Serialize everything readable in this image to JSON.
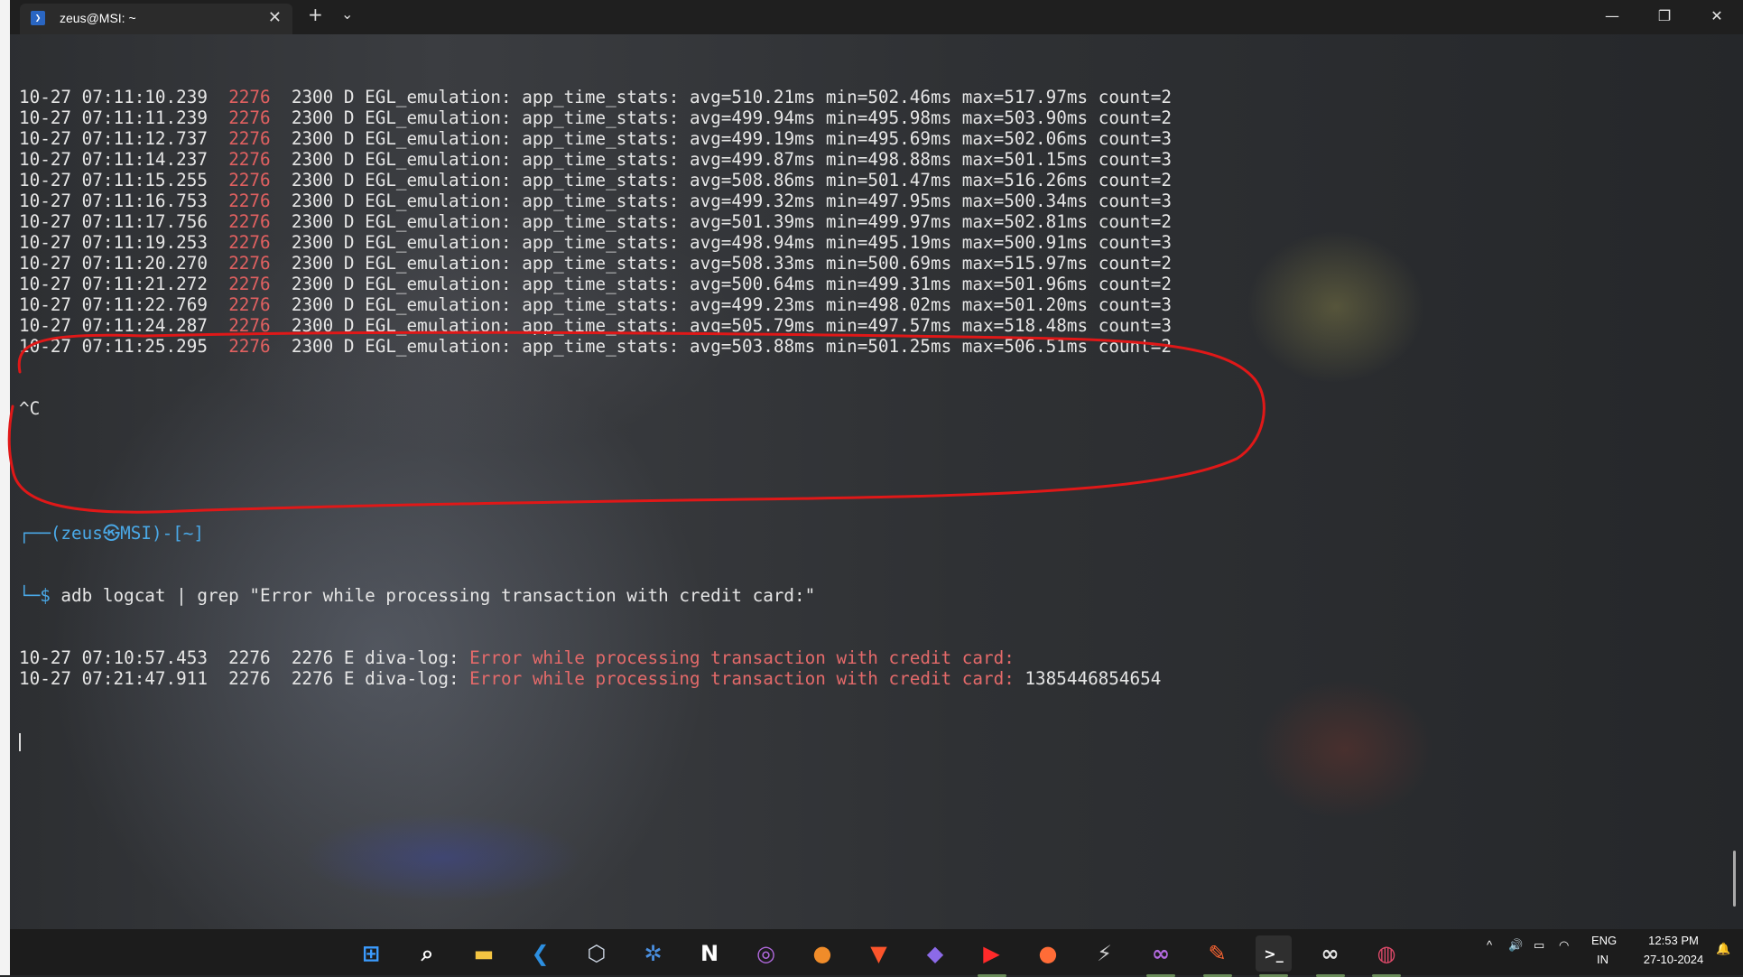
{
  "window": {
    "tab_title": "zeus@MSI: ~",
    "tab_icon": "powershell-icon",
    "new_tab": "+",
    "dropdown": "⌄",
    "minimize": "—",
    "restore": "❐",
    "close": "✕"
  },
  "log_lines": [
    {
      "date": "10-27",
      "time": "07:11:10.239",
      "pid": "2276",
      "tid": "2300",
      "level": "D",
      "tag": "EGL_emulation:",
      "msg": "app_time_stats: avg=510.21ms min=502.46ms max=517.97ms count=2"
    },
    {
      "date": "10-27",
      "time": "07:11:11.239",
      "pid": "2276",
      "tid": "2300",
      "level": "D",
      "tag": "EGL_emulation:",
      "msg": "app_time_stats: avg=499.94ms min=495.98ms max=503.90ms count=2"
    },
    {
      "date": "10-27",
      "time": "07:11:12.737",
      "pid": "2276",
      "tid": "2300",
      "level": "D",
      "tag": "EGL_emulation:",
      "msg": "app_time_stats: avg=499.19ms min=495.69ms max=502.06ms count=3"
    },
    {
      "date": "10-27",
      "time": "07:11:14.237",
      "pid": "2276",
      "tid": "2300",
      "level": "D",
      "tag": "EGL_emulation:",
      "msg": "app_time_stats: avg=499.87ms min=498.88ms max=501.15ms count=3"
    },
    {
      "date": "10-27",
      "time": "07:11:15.255",
      "pid": "2276",
      "tid": "2300",
      "level": "D",
      "tag": "EGL_emulation:",
      "msg": "app_time_stats: avg=508.86ms min=501.47ms max=516.26ms count=2"
    },
    {
      "date": "10-27",
      "time": "07:11:16.753",
      "pid": "2276",
      "tid": "2300",
      "level": "D",
      "tag": "EGL_emulation:",
      "msg": "app_time_stats: avg=499.32ms min=497.95ms max=500.34ms count=3"
    },
    {
      "date": "10-27",
      "time": "07:11:17.756",
      "pid": "2276",
      "tid": "2300",
      "level": "D",
      "tag": "EGL_emulation:",
      "msg": "app_time_stats: avg=501.39ms min=499.97ms max=502.81ms count=2"
    },
    {
      "date": "10-27",
      "time": "07:11:19.253",
      "pid": "2276",
      "tid": "2300",
      "level": "D",
      "tag": "EGL_emulation:",
      "msg": "app_time_stats: avg=498.94ms min=495.19ms max=500.91ms count=3"
    },
    {
      "date": "10-27",
      "time": "07:11:20.270",
      "pid": "2276",
      "tid": "2300",
      "level": "D",
      "tag": "EGL_emulation:",
      "msg": "app_time_stats: avg=508.33ms min=500.69ms max=515.97ms count=2"
    },
    {
      "date": "10-27",
      "time": "07:11:21.272",
      "pid": "2276",
      "tid": "2300",
      "level": "D",
      "tag": "EGL_emulation:",
      "msg": "app_time_stats: avg=500.64ms min=499.31ms max=501.96ms count=2"
    },
    {
      "date": "10-27",
      "time": "07:11:22.769",
      "pid": "2276",
      "tid": "2300",
      "level": "D",
      "tag": "EGL_emulation:",
      "msg": "app_time_stats: avg=499.23ms min=498.02ms max=501.20ms count=3"
    },
    {
      "date": "10-27",
      "time": "07:11:24.287",
      "pid": "2276",
      "tid": "2300",
      "level": "D",
      "tag": "EGL_emulation:",
      "msg": "app_time_stats: avg=505.79ms min=497.57ms max=518.48ms count=3"
    },
    {
      "date": "10-27",
      "time": "07:11:25.295",
      "pid": "2276",
      "tid": "2300",
      "level": "D",
      "tag": "EGL_emulation:",
      "msg": "app_time_stats: avg=503.88ms min=501.25ms max=506.51ms count=2"
    }
  ],
  "interrupt": "^C",
  "prompt": {
    "top": "┌──(zeus㉿MSI)-[~]",
    "bottom_prefix": "└─$",
    "command": " adb logcat | grep \"Error while processing transaction with credit card:\""
  },
  "grep_results": [
    {
      "prefix": "10-27 07:10:57.453  2276  2276 E diva-log: ",
      "error": "Error while processing transaction with credit card:",
      "value": ""
    },
    {
      "prefix": "10-27 07:21:47.911  2276  2276 E diva-log: ",
      "error": "Error while processing transaction with credit card:",
      "value": " 1385446854654"
    }
  ],
  "taskbar": {
    "apps": [
      {
        "name": "windows-start-icon",
        "glyph": "⊞",
        "color": "#3b9cff"
      },
      {
        "name": "search-icon",
        "glyph": "⌕",
        "color": "#ffffff"
      },
      {
        "name": "file-explorer-icon",
        "glyph": "▬",
        "color": "#f4c542"
      },
      {
        "name": "vscode-icon",
        "glyph": "❮",
        "color": "#2d8fe0"
      },
      {
        "name": "virtualbox-icon",
        "glyph": "⬡",
        "color": "#cfd8e6"
      },
      {
        "name": "app-bug-icon",
        "glyph": "✲",
        "color": "#4a8fe0"
      },
      {
        "name": "notion-icon",
        "glyph": "N",
        "color": "#ffffff"
      },
      {
        "name": "app-purple-icon",
        "glyph": "◎",
        "color": "#b36ae0"
      },
      {
        "name": "fl-studio-icon",
        "glyph": "●",
        "color": "#f08c2a"
      },
      {
        "name": "brave-icon",
        "glyph": "▼",
        "color": "#fb542b"
      },
      {
        "name": "obsidian-icon",
        "glyph": "◆",
        "color": "#8c6ae8"
      },
      {
        "name": "youtube-icon",
        "glyph": "▶",
        "color": "#ff2a2a"
      },
      {
        "name": "postman-icon",
        "glyph": "●",
        "color": "#ff6c37"
      },
      {
        "name": "app-terminal2-icon",
        "glyph": "⚡",
        "color": "#cccccc"
      },
      {
        "name": "app-infinity-icon",
        "glyph": "∞",
        "color": "#b46ae0"
      },
      {
        "name": "burp-icon",
        "glyph": "✎",
        "color": "#ff6633"
      },
      {
        "name": "terminal-icon",
        "glyph": ">_",
        "color": "#ffffff"
      },
      {
        "name": "app-mask-icon",
        "glyph": "∞",
        "color": "#e6e6e6"
      },
      {
        "name": "app-chrome-dev-icon",
        "glyph": "◍",
        "color": "#e04a6a"
      }
    ],
    "tray": {
      "chevron": "^",
      "lang_top": "ENG",
      "lang_bottom": "IN",
      "time": "12:53 PM",
      "date": "27-10-2024"
    }
  }
}
